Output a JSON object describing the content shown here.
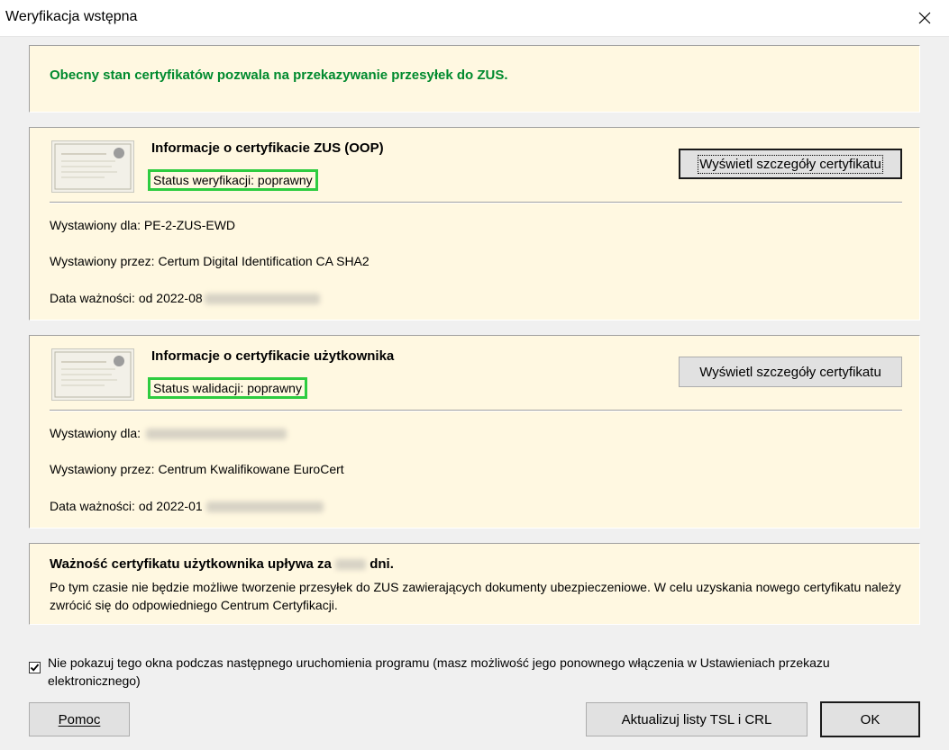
{
  "window": {
    "title": "Weryfikacja wstępna",
    "close_icon": "close-icon"
  },
  "banner": {
    "message": "Obecny stan certyfikatów pozwala na przekazywanie przesyłek do ZUS.",
    "color": "#008a2e"
  },
  "zus_cert": {
    "heading": "Informacje o certyfikacie ZUS (OOP)",
    "status": "Status weryfikacji: poprawny",
    "details_button": "Wyświetl szczegóły certyfikatu",
    "issued_for": "Wystawiony dla: PE-2-ZUS-EWD",
    "issued_by": "Wystawiony przez: Certum Digital Identification CA SHA2",
    "validity": "Data ważności: od 2022-08"
  },
  "user_cert": {
    "heading": "Informacje o certyfikacie użytkownika",
    "status": "Status walidacji: poprawny",
    "details_button": "Wyświetl szczegóły certyfikatu",
    "issued_for": "Wystawiony dla:",
    "issued_by": "Wystawiony przez: Centrum Kwalifikowane EuroCert",
    "validity": "Data ważności: od 2022-01"
  },
  "expiry": {
    "title_prefix": "Ważność certyfikatu użytkownika upływa za",
    "title_suffix": "dni.",
    "body": "Po tym czasie nie będzie możliwe tworzenie przesyłek do ZUS zawierających dokumenty ubezpieczeniowe. W celu uzyskania nowego certyfikatu należy zwrócić się do odpowiedniego Centrum Certyfikacji."
  },
  "dont_show": {
    "checked": true,
    "label": "Nie pokazuj tego okna podczas następnego uruchomienia programu (masz możliwość jego ponownego włączenia w Ustawieniach przekazu elektronicznego)"
  },
  "buttons": {
    "help": "Pomoc",
    "update_lists": "Aktualizuj listy TSL i CRL",
    "ok": "OK"
  },
  "colors": {
    "panel_bg": "#fff8e1",
    "status_highlight": "#2ecc40",
    "dialog_bg": "#f0f0f0"
  }
}
